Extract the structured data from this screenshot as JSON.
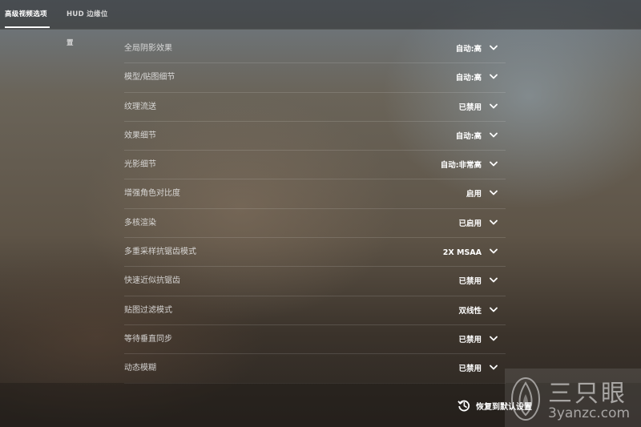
{
  "tabs": [
    {
      "label": "高级视频选项",
      "active": true
    },
    {
      "label": "HUD 边缘位置",
      "active": false
    }
  ],
  "settings": [
    {
      "label": "全局阴影效果",
      "value": "自动:高"
    },
    {
      "label": "模型/贴图细节",
      "value": "自动:高"
    },
    {
      "label": "纹理流送",
      "value": "已禁用"
    },
    {
      "label": "效果细节",
      "value": "自动:高"
    },
    {
      "label": "光影细节",
      "value": "自动:非常高"
    },
    {
      "label": "增强角色对比度",
      "value": "启用"
    },
    {
      "label": "多核渲染",
      "value": "已启用"
    },
    {
      "label": "多重采样抗锯齿模式",
      "value": "2X MSAA"
    },
    {
      "label": "快速近似抗锯齿",
      "value": "已禁用"
    },
    {
      "label": "贴图过滤模式",
      "value": "双线性"
    },
    {
      "label": "等待垂直同步",
      "value": "已禁用"
    },
    {
      "label": "动态模糊",
      "value": "已禁用"
    }
  ],
  "footer": {
    "restore_label": "恢复到默认设置",
    "restore_icon": "restore-history-icon"
  },
  "watermark": {
    "title": "三只眼",
    "url": "3yanzc.com"
  }
}
